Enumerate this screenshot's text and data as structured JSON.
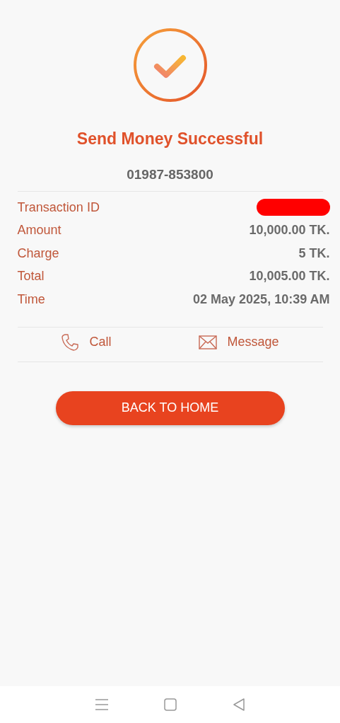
{
  "status": {
    "title": "Send Money Successful",
    "phone": "01987-853800"
  },
  "details": [
    {
      "label": "Transaction ID",
      "redacted": true
    },
    {
      "label": "Amount",
      "value": "10,000.00 TK.",
      "redacted": false
    },
    {
      "label": "Charge",
      "value": "5 TK.",
      "redacted": false
    },
    {
      "label": "Total",
      "value": "10,005.00 TK.",
      "redacted": false
    },
    {
      "label": "Time",
      "value": "02 May 2025, 10:39 AM",
      "redacted": false
    }
  ],
  "actions": [
    {
      "kind": "call",
      "label": "Call"
    },
    {
      "kind": "message",
      "label": "Message"
    }
  ],
  "button": "BACK TO HOME"
}
